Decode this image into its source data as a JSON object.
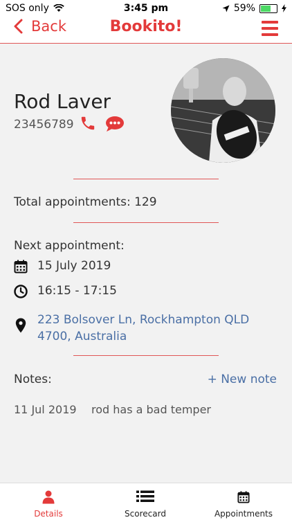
{
  "status_bar": {
    "carrier": "SOS only",
    "time": "3:45 pm",
    "battery": "59%",
    "battery_level": 0.59
  },
  "nav": {
    "back_label": "Back",
    "brand": "Bookito!"
  },
  "profile": {
    "name": "Rod Laver",
    "phone": "23456789"
  },
  "summary": {
    "total_appointments": "Total appointments: 129"
  },
  "next_appointment": {
    "label": "Next appointment:",
    "date": "15 July 2019",
    "time": "16:15 - 17:15",
    "address_line1": "223 Bolsover Ln, Rockhampton QLD",
    "address_line2": "4700, Australia"
  },
  "notes": {
    "label": "Notes:",
    "new_note": "+ New note",
    "items": [
      {
        "date": "11 Jul 2019",
        "text": "rod has a bad temper"
      }
    ]
  },
  "tabs": [
    {
      "label": "Details",
      "icon": "person-icon",
      "active": true
    },
    {
      "label": "Scorecard",
      "icon": "list-icon",
      "active": false
    },
    {
      "label": "Appointments",
      "icon": "calendar-icon",
      "active": false
    }
  ],
  "colors": {
    "accent": "#e33a3a",
    "link": "#4a6fa5",
    "background": "#f2f2f2"
  }
}
